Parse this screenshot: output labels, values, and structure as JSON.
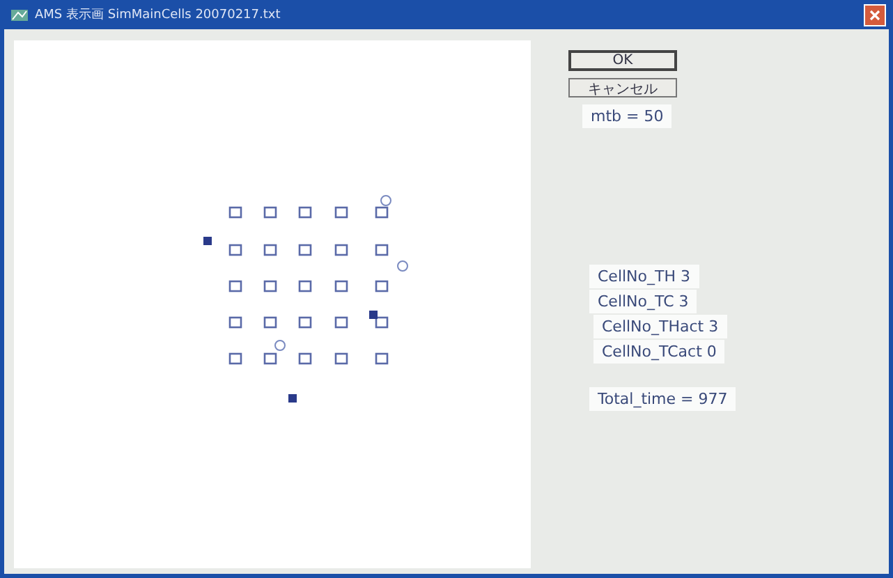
{
  "window": {
    "title": "AMS 表示画 SimMainCells 20070217.txt"
  },
  "buttons": [
    {
      "label": "OK",
      "kind": "default"
    },
    {
      "label": "キャンセル",
      "kind": "normal"
    }
  ],
  "mtb": "mtb = 50",
  "counters": [
    {
      "text": "CellNo_TH  3",
      "kind": "main"
    },
    {
      "text": "CellNo_TC  3",
      "kind": "main"
    },
    {
      "text": "CellNo_THact  3",
      "kind": "sub"
    },
    {
      "text": "CellNo_TCact  0",
      "kind": "sub"
    }
  ],
  "total": "Total_time = 977"
}
